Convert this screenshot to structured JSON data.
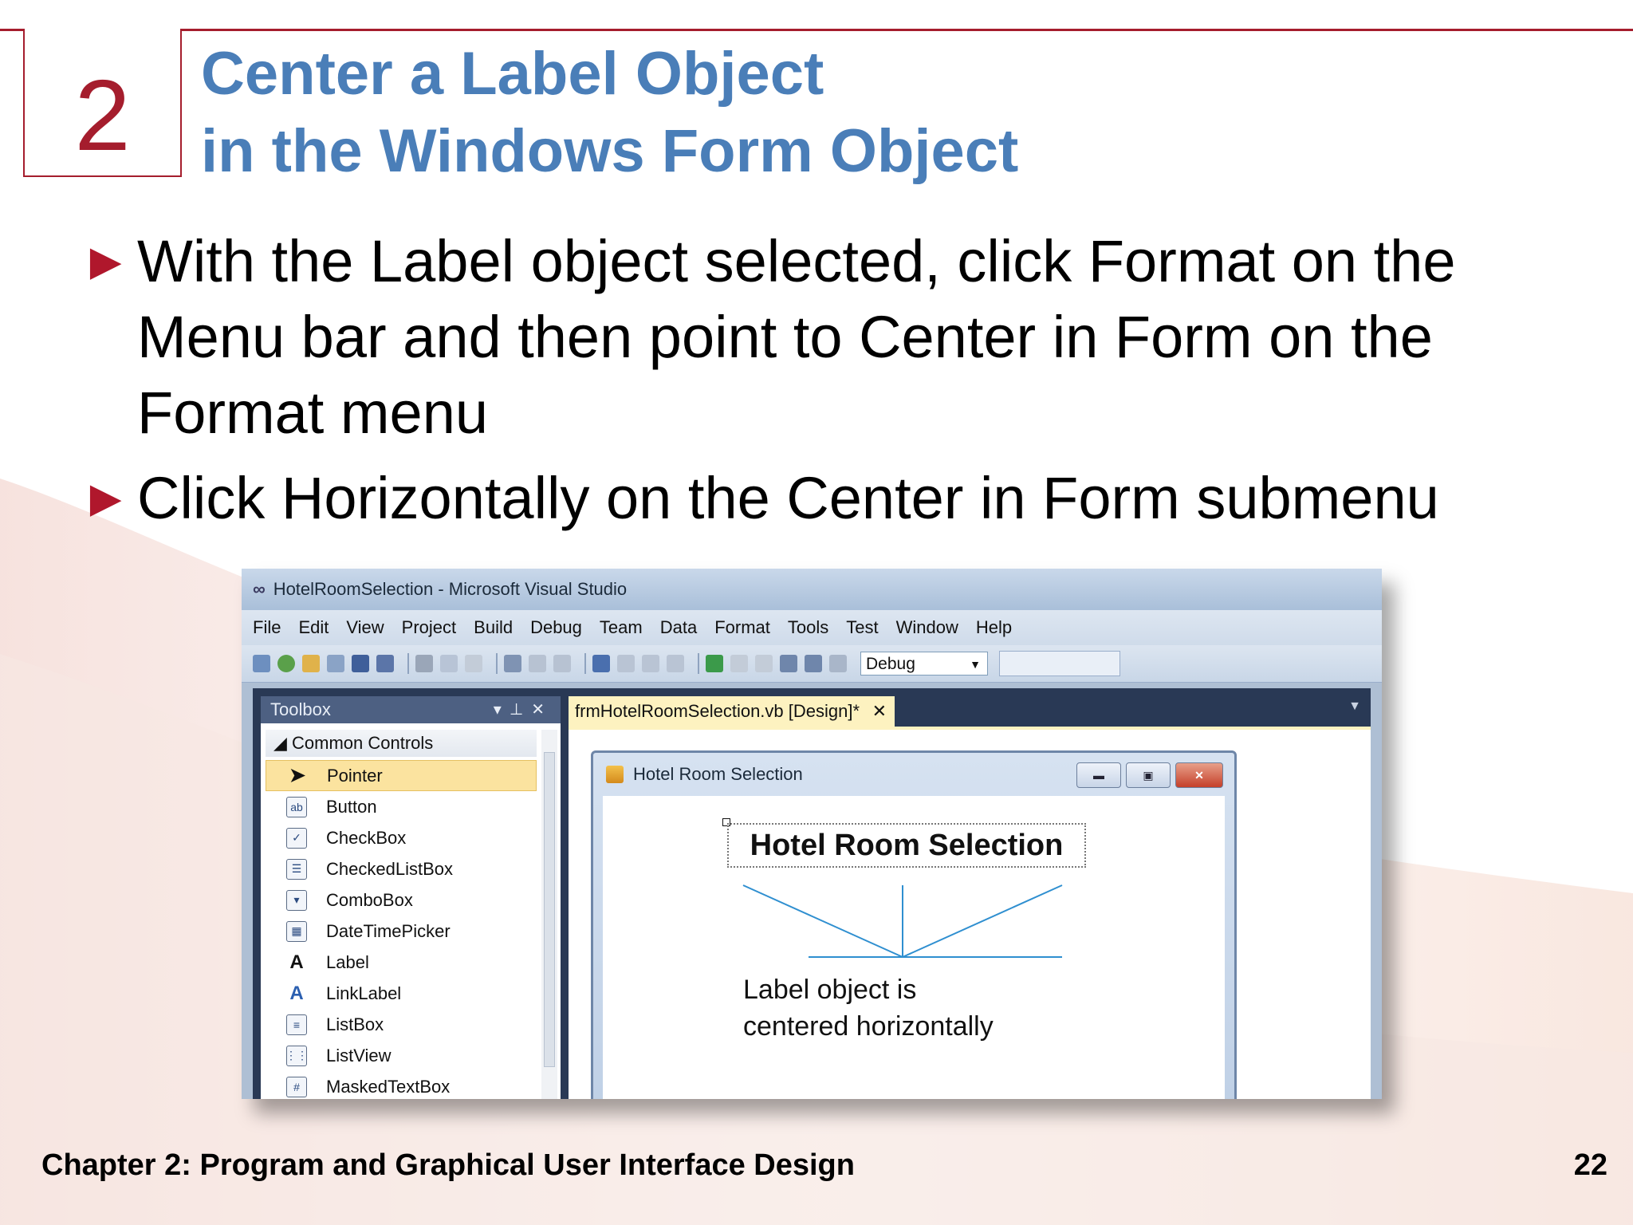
{
  "slide": {
    "number": "2",
    "title_line1": "Center a Label Object",
    "title_line2": "in the Windows Form Object",
    "bullets": [
      "With the Label object selected, click Format on the Menu bar and then point to Center in Form on the Format menu",
      "Click Horizontally on the Center in Form submenu"
    ],
    "footer": "Chapter 2: Program and Graphical User Interface Design",
    "page": "22",
    "colors": {
      "accent_red": "#a51d2d",
      "title_blue": "#4a7eb8"
    }
  },
  "vs": {
    "window_title": "HotelRoomSelection - Microsoft Visual Studio",
    "menu": [
      "File",
      "Edit",
      "View",
      "Project",
      "Build",
      "Debug",
      "Team",
      "Data",
      "Format",
      "Tools",
      "Test",
      "Window",
      "Help"
    ],
    "config": "Debug",
    "toolbox": {
      "title": "Toolbox",
      "group": "Common Controls",
      "items": [
        {
          "label": "Pointer",
          "icon": "pointer-icon"
        },
        {
          "label": "Button",
          "icon": "button-icon"
        },
        {
          "label": "CheckBox",
          "icon": "checkbox-icon"
        },
        {
          "label": "CheckedListBox",
          "icon": "checkedlistbox-icon"
        },
        {
          "label": "ComboBox",
          "icon": "combobox-icon"
        },
        {
          "label": "DateTimePicker",
          "icon": "datetimepicker-icon"
        },
        {
          "label": "Label",
          "icon": "label-icon"
        },
        {
          "label": "LinkLabel",
          "icon": "linklabel-icon"
        },
        {
          "label": "ListBox",
          "icon": "listbox-icon"
        },
        {
          "label": "ListView",
          "icon": "listview-icon"
        },
        {
          "label": "MaskedTextBox",
          "icon": "maskedtextbox-icon"
        }
      ]
    },
    "tab": "frmHotelRoomSelection.vb [Design]*",
    "form": {
      "title": "Hotel Room Selection",
      "label_text": "Hotel Room Selection"
    },
    "callout_line1": "Label object is",
    "callout_line2": "centered horizontally"
  }
}
